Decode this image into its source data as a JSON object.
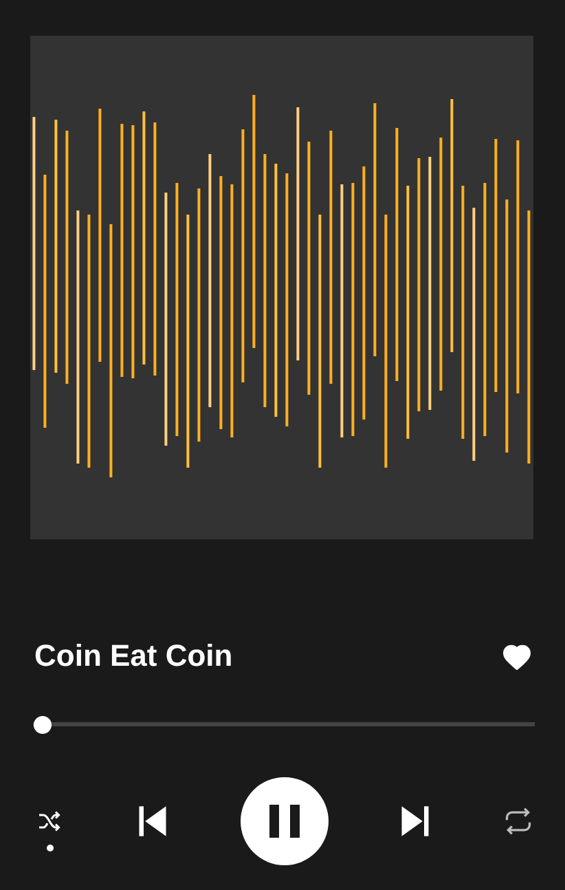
{
  "track": {
    "title": "Coin Eat Coin",
    "liked": true
  },
  "progress": {
    "level": 0.02
  },
  "controls": {
    "shuffle": true,
    "repeat": false,
    "playing": true
  }
}
